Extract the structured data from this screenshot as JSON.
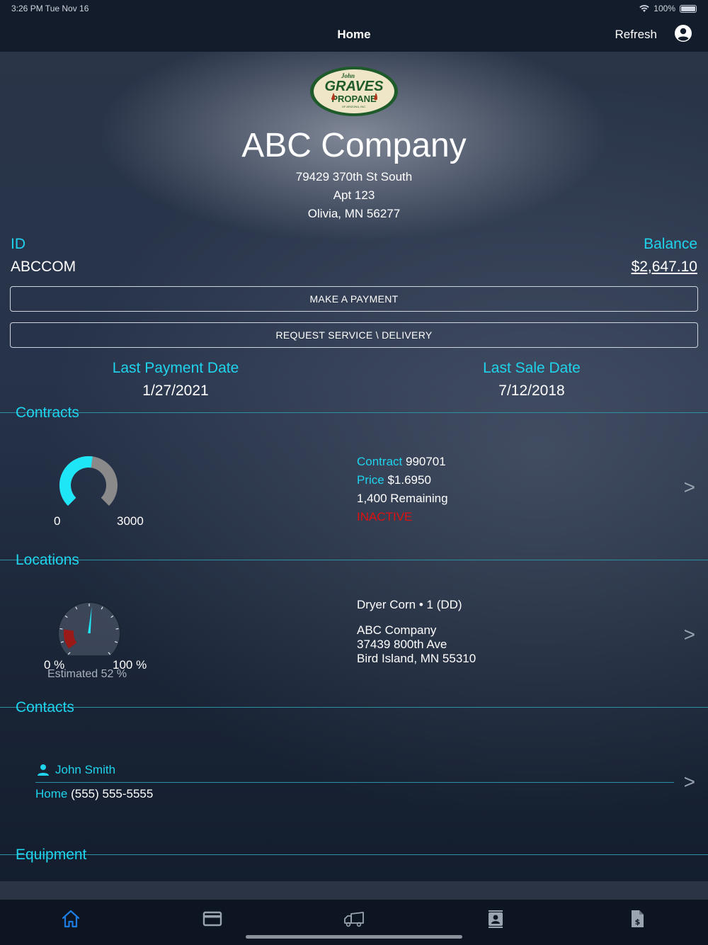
{
  "status_bar": {
    "time": "3:26 PM   Tue Nov 16",
    "battery": "100%"
  },
  "nav": {
    "title": "Home",
    "refresh_label": "Refresh"
  },
  "header": {
    "logo_text": {
      "top": "John",
      "main": "GRAVES",
      "sub": "PROPANE",
      "foot": "OF ARIZONA, INC."
    },
    "company_name": "ABC Company",
    "address": [
      "79429 370th St South",
      "Apt 123",
      "Olivia, MN 56277"
    ]
  },
  "account": {
    "id_label": "ID",
    "id_value": "ABCCOM",
    "balance_label": "Balance",
    "balance_value": "$2,647.10"
  },
  "actions": {
    "make_payment": "MAKE A PAYMENT",
    "request_service": "REQUEST SERVICE \\ DELIVERY"
  },
  "dates": {
    "last_payment_label": "Last Payment Date",
    "last_payment_value": "1/27/2021",
    "last_sale_label": "Last Sale Date",
    "last_sale_value": "7/12/2018"
  },
  "sections": {
    "contracts": "Contracts",
    "locations": "Locations",
    "contacts": "Contacts",
    "equipment": "Equipment"
  },
  "contract": {
    "gauge_min": "0",
    "gauge_max": "3000",
    "gauge_fraction": 0.53,
    "contract_label": "Contract",
    "contract_value": "990701",
    "price_label": "Price",
    "price_value": "$1.6950",
    "remaining": "1,400 Remaining",
    "status": "INACTIVE",
    "chevron": ">"
  },
  "location": {
    "tank_min": "0 %",
    "tank_max": "100 %",
    "estimated": "Estimated 52 %",
    "estimated_percent": 52,
    "name": "Dryer Corn • 1 (DD)",
    "address": [
      "ABC Company",
      "37439 800th Ave",
      "Bird Island, MN  55310"
    ],
    "chevron": ">"
  },
  "contact": {
    "name": "John Smith",
    "phone_label": "Home",
    "phone_value": "(555) 555-5555",
    "chevron": ">"
  },
  "colors": {
    "accent": "#1fd4ec",
    "active_tab": "#1e7be0",
    "inactive": "#e01010"
  },
  "tabs": [
    {
      "icon": "home-icon",
      "active": true
    },
    {
      "icon": "credit-card-icon",
      "active": false
    },
    {
      "icon": "delivery-truck-icon",
      "active": false
    },
    {
      "icon": "contact-book-icon",
      "active": false
    },
    {
      "icon": "invoice-dollar-icon",
      "active": false
    }
  ]
}
